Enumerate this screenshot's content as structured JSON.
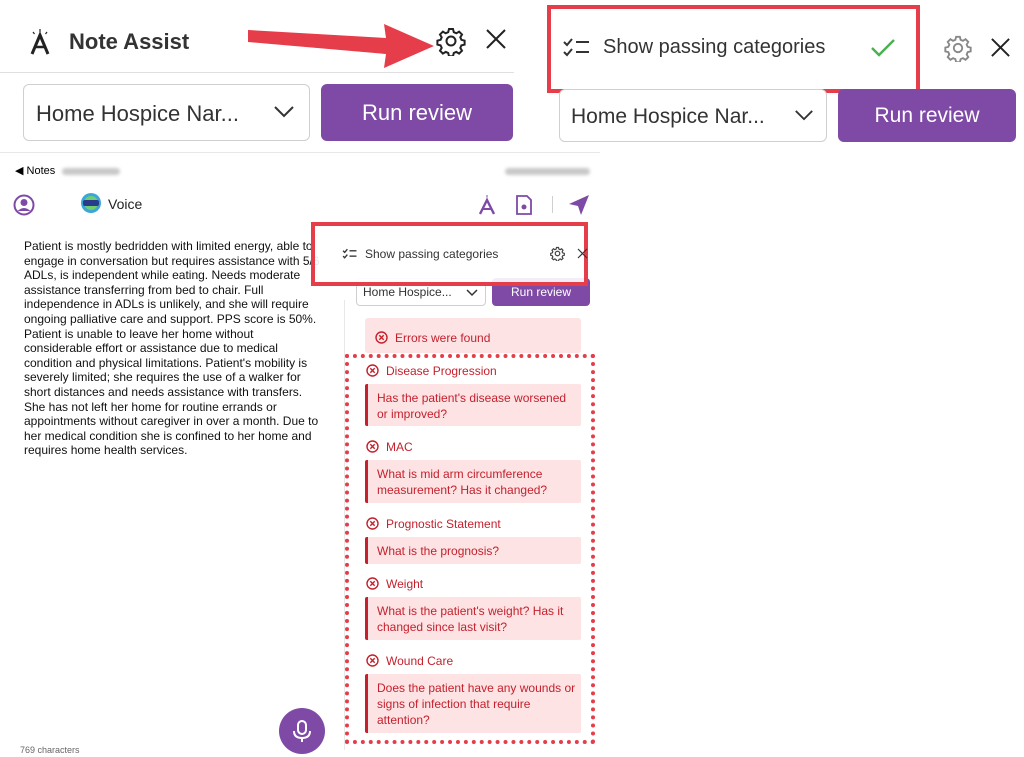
{
  "top_left_panel": {
    "title": "Note Assist",
    "template_select_value": "Home Hospice Nar...",
    "run_button_label": "Run review"
  },
  "top_right_panel": {
    "show_passing_label": "Show passing categories",
    "template_select_value": "Home Hospice Nar...",
    "run_button_label": "Run review"
  },
  "phone": {
    "back_label": "◀ Notes",
    "voice_label": "Voice",
    "note_text": "Patient is mostly bedridden with limited energy, able to engage in conversation but requires assistance with 5/6 ADLs, is independent while eating. Needs moderate assistance transferring from bed to chair. Full independence in ADLs is unlikely, and she will require ongoing palliative care and support. PPS score is 50%. Patient is unable to leave her home without considerable effort or assistance due to medical condition and physical limitations. Patient's mobility is severely limited; she requires the use of a walker for short distances and needs assistance with transfers. She has not left her home for routine errands or appointments without caregiver in over a month. Due to her medical condition she is confined to her home and requires home health services.",
    "char_count": "769 characters"
  },
  "small_panel": {
    "show_passing_label": "Show passing categories",
    "template_select_value": "Home Hospice...",
    "run_button_label": "Run review",
    "errors_banner": "Errors were found",
    "categories": [
      {
        "title": "Disease Progression",
        "question": "Has the patient's disease worsened or improved?"
      },
      {
        "title": "MAC",
        "question": "What is mid arm circumference measurement? Has it changed?"
      },
      {
        "title": "Prognostic Statement",
        "question": "What is the prognosis?"
      },
      {
        "title": "Weight",
        "question": "What is the patient's weight? Has it changed since last visit?"
      },
      {
        "title": "Wound Care",
        "question": "Does the patient have any wounds or signs of infection that require attention?"
      }
    ]
  },
  "colors": {
    "brand_purple": "#7e4aa6",
    "error_red": "#c4212d",
    "error_bg": "#fde3e4",
    "highlight_red": "#e53d4a",
    "check_green": "#4caf50"
  },
  "icons": [
    "note-assist-logo-icon",
    "gear-icon",
    "close-icon",
    "chevron-down-icon",
    "checklist-icon",
    "checkmark-icon",
    "user-icon",
    "voice-logo-icon",
    "note-assist-icon",
    "document-icon",
    "send-icon",
    "microphone-icon",
    "error-circle-icon"
  ]
}
